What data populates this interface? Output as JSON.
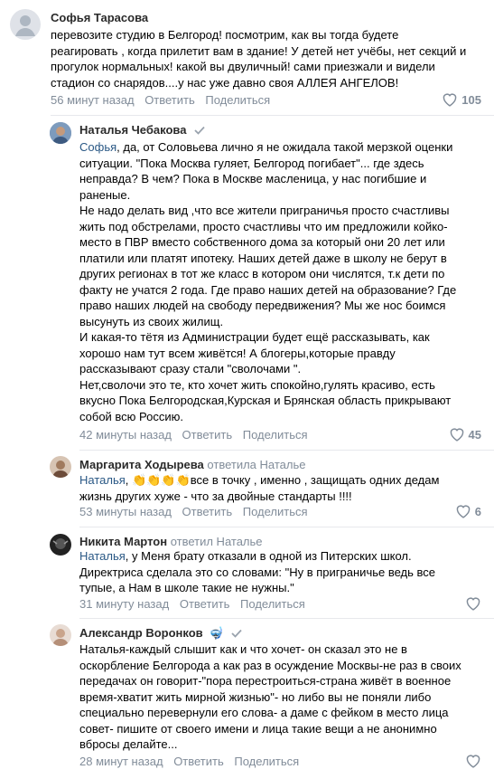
{
  "comments": [
    {
      "author": "Софья Тарасова",
      "replied_to": "",
      "verified": false,
      "lines": [
        "перевозите студию в Белгород! посмотрим, как вы тогда будете",
        "реагировать , когда прилетит вам в здание! У детей нет учёбы, нет секций и",
        "прогулок нормальных! какой вы двуличный! сами приезжали и видели",
        "стадион со снарядов....у нас уже давно своя АЛЛЕЯ АНГЕЛОВ!"
      ],
      "time": "56 минут назад",
      "reply_label": "Ответить",
      "share_label": "Поделиться",
      "likes": "105"
    },
    {
      "author": "Наталья Чебакова",
      "replied_to": "",
      "verified": true,
      "mention": "Софья",
      "lines": [
        ", да, от Соловьева лично я не ожидала такой мерзкой оценки",
        "ситуации. \"Пока Москва гуляет, Белгород погибает\"... где здесь",
        "неправда? В чем? Пока в Москве масленица, у нас погибшие и",
        "раненые.",
        "Не надо делать вид ,что все жители приграничья просто счастливы",
        "жить под обстрелами, просто счастливы что им предложили койко-",
        "место в ПВР вместо собственного дома за который они 20 лет или",
        "платили или платят ипотеку. Наших детей даже в школу не берут в",
        "других регионах в тот же класс в котором они числятся, т.к дети по",
        "факту не учатся 2 года. Где право наших детей на образование? Где",
        "право наших людей на свободу передвижения? Мы же нос боимся",
        "высунуть из своих жилищ.",
        "И какая-то тётя из Администрации будет ещё рассказывать, как",
        "хорошо нам тут всем живётся! А блогеры,которые правду",
        "рассказывают сразу стали \"сволочами \".",
        "Нет,сволочи это те, кто хочет жить спокойно,гулять красиво, есть",
        "вкусно Пока Белгородская,Курская и Брянская область прикрывают",
        "собой всю Россию."
      ],
      "time": "42 минуты назад",
      "reply_label": "Ответить",
      "share_label": "Поделиться",
      "likes": "45"
    },
    {
      "author": "Маргарита Ходырева",
      "replied_to": "ответила Наталье",
      "verified": false,
      "mention": "Наталья",
      "emojis": "👏👏👏👏",
      "lines": [
        "все в точку , именно , защищать одних дедам",
        "жизнь других хуже - что за двойные стандарты !!!!"
      ],
      "time": "53 минуты назад",
      "reply_label": "Ответить",
      "share_label": "Поделиться",
      "likes": "6"
    },
    {
      "author": "Никита Мартон",
      "replied_to": "ответил Наталье",
      "verified": false,
      "mention": "Наталья",
      "lines": [
        ", у Меня брату отказали в одной из Питерских школ.",
        "Директриса сделала это со словами: \"Ну в приграничье ведь все",
        "тупые, а Нам в школе такие не нужны.\""
      ],
      "time": "31 минуту назад",
      "reply_label": "Ответить",
      "share_label": "Поделиться",
      "likes": ""
    },
    {
      "author": "Александр Воронков",
      "replied_to": "",
      "verified": true,
      "badge": "🤿",
      "lines": [
        "Наталья-каждый слышит как и что хочет- он сказал это не в",
        "оскорбление Белгорода а как раз в осуждение Москвы-не раз в своих",
        "передачах он говорит-\"пора перестроиться-страна живёт в военное",
        "время-хватит жить мирной жизнью\"- но либо вы не поняли либо",
        "специально перевернули его слова- а даме с фейком в место лица",
        "совет- пишите от своего имени и лица такие вещи а не анонимно",
        "вбросы делайте..."
      ],
      "time": "28 минут назад",
      "reply_label": "Ответить",
      "share_label": "Поделиться",
      "likes": ""
    }
  ]
}
